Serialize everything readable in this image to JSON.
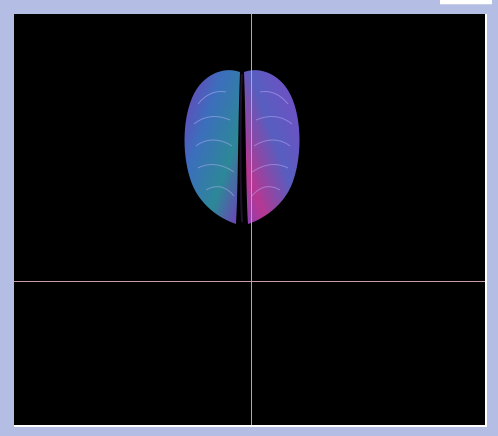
{
  "viewer": {
    "background_color": "#000000",
    "frame_color": "#b4bee4",
    "crosshair_vertical_color": "#a7a4d6",
    "crosshair_horizontal_color": "#c89aae",
    "render": {
      "object": "brain-surface-render",
      "colors": [
        "#7a3fc4",
        "#3f74c6",
        "#c03a9a",
        "#2f8f9f"
      ]
    }
  }
}
